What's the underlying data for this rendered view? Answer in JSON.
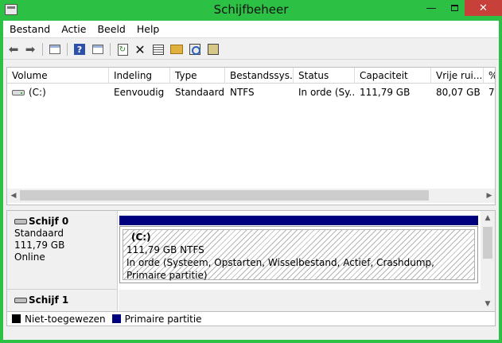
{
  "window": {
    "title": "Schijfbeheer",
    "min_glyph": "—",
    "close_glyph": "✕"
  },
  "menu": [
    "Bestand",
    "Actie",
    "Beeld",
    "Help"
  ],
  "toolbar_icons": [
    "back-arrow-icon",
    "forward-arrow-icon",
    "console-tree-icon",
    "help-icon",
    "details-pane-icon",
    "refresh-icon",
    "delete-icon",
    "properties-icon",
    "open-icon",
    "find-icon",
    "snapshot-icon"
  ],
  "volume_list": {
    "columns": [
      "Volume",
      "Indeling",
      "Type",
      "Bestandssys...",
      "Status",
      "Capaciteit",
      "Vrije rui...",
      "%"
    ],
    "rows": [
      {
        "volume": "(C:)",
        "layout": "Eenvoudig",
        "type": "Standaard",
        "fs": "NTFS",
        "status": "In orde (Sy...",
        "capacity": "111,79 GB",
        "free": "80,07 GB",
        "pct": "7."
      }
    ]
  },
  "disks": [
    {
      "name": "Schijf 0",
      "kind": "Standaard",
      "size": "111,79 GB",
      "state": "Online",
      "partition": {
        "label": "(C:)",
        "size_fs": "111,79 GB NTFS",
        "status": "In orde (Systeem, Opstarten, Wisselbestand, Actief, Crashdump, Primaire partitie)"
      }
    },
    {
      "name": "Schijf 1"
    }
  ],
  "legend": [
    {
      "label": "Niet-toegewezen",
      "color": "#000000"
    },
    {
      "label": "Primaire partitie",
      "color": "#00007f"
    }
  ],
  "colors": {
    "titlebar": "#2cc044",
    "close_button": "#c7413a",
    "primary_partition": "#00007f"
  }
}
